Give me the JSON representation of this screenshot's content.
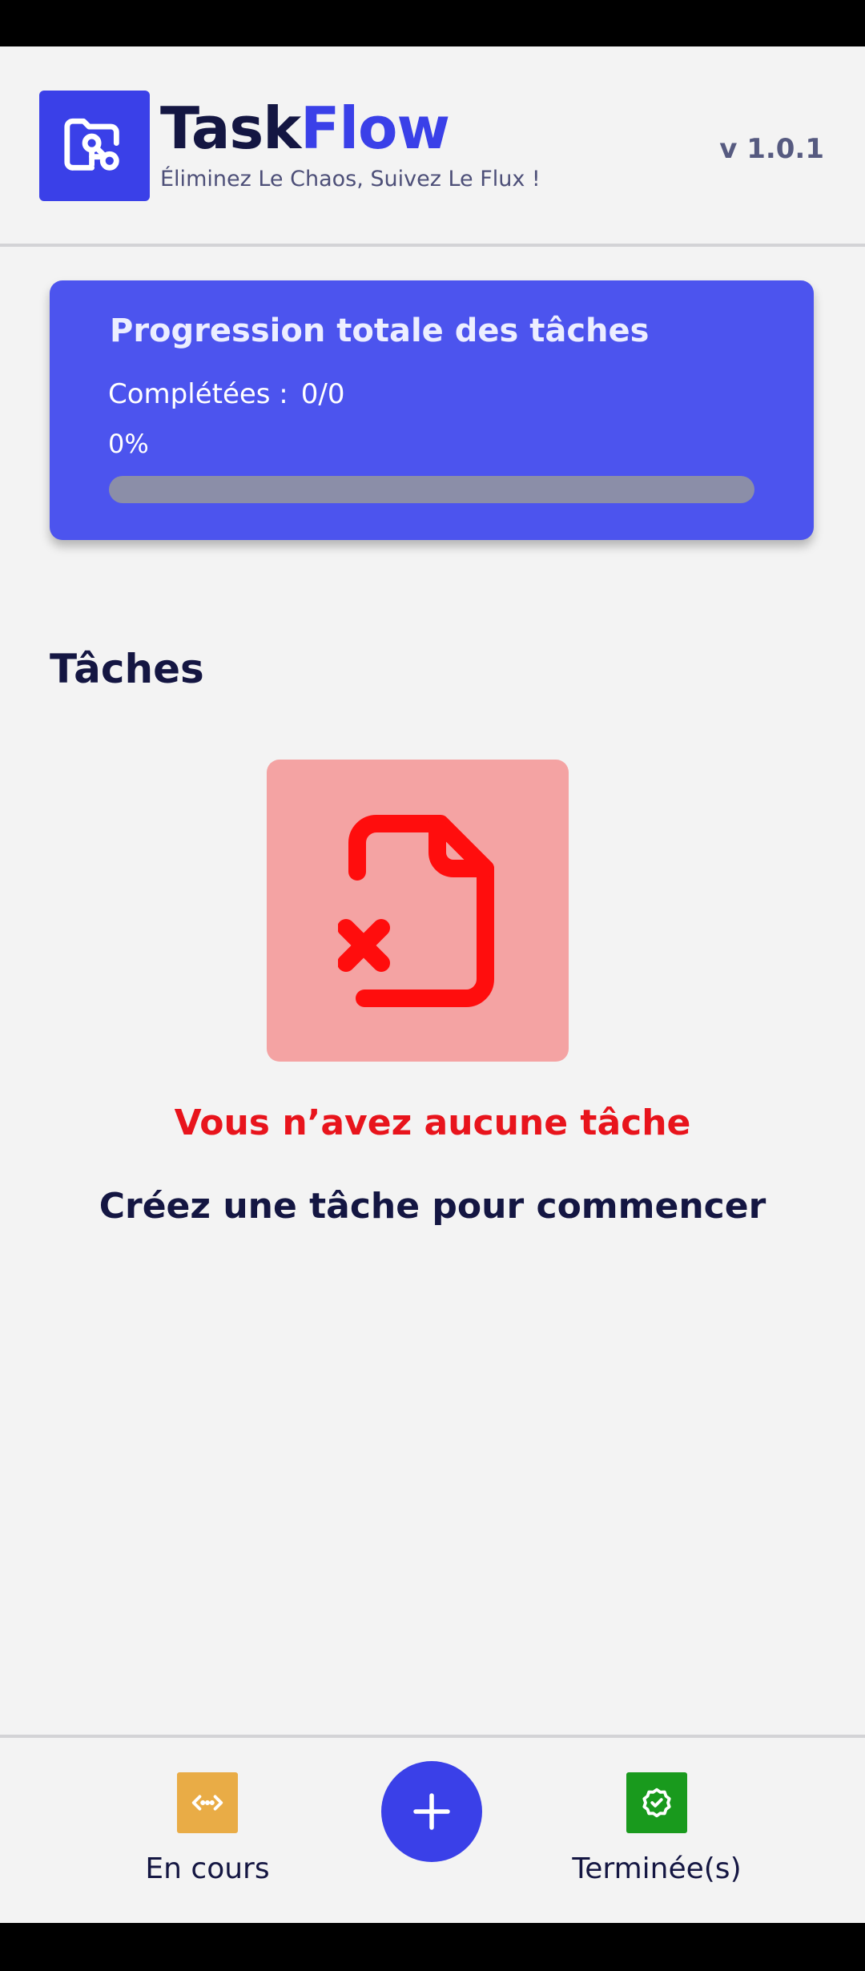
{
  "header": {
    "title_part1": "Task",
    "title_part2": "Flow",
    "tagline": "Éliminez Le Chaos, Suivez Le Flux !",
    "version": "v 1.0.1",
    "logo_icon": "folder-key-icon"
  },
  "progress": {
    "title": "Progression totale des tâches",
    "completed_label": "Complétées :",
    "completed_value": "0/0",
    "percent_label": "0%",
    "fraction": 0
  },
  "tasks": {
    "section_title": "Tâches",
    "empty_icon": "file-x-icon",
    "empty_title": "Vous n’avez aucune tâche",
    "empty_subtitle": "Créez une tâche pour commencer"
  },
  "bottom_nav": {
    "ongoing_label": "En cours",
    "ongoing_icon": "code-dots-icon",
    "add_icon": "plus-icon",
    "done_label": "Terminée(s)",
    "done_icon": "check-badge-icon"
  },
  "colors": {
    "brand": "#3a40e8",
    "card": "#4c54ee",
    "dark_text": "#141642",
    "error": "#e8141c",
    "empty_bg": "#f4a3a3",
    "ongoing": "#e9ac46",
    "done": "#199a1d"
  }
}
